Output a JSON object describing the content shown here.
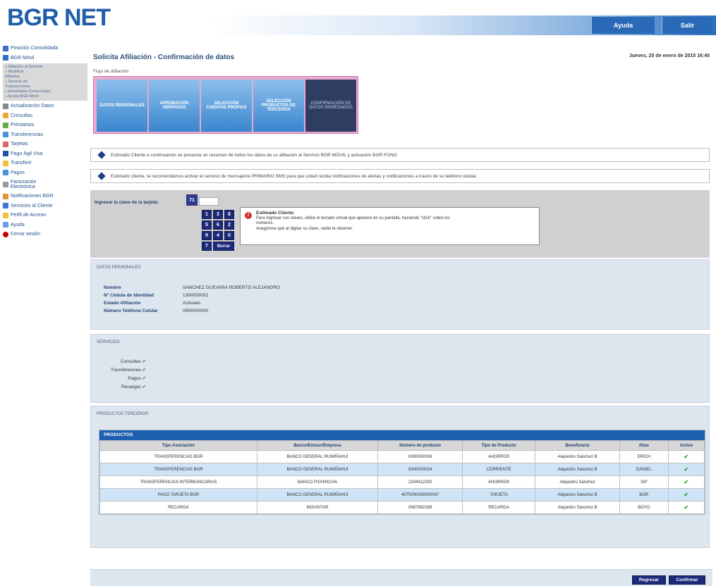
{
  "brand": {
    "logo": "BGR NET"
  },
  "header": {
    "help_label": "Ayuda",
    "exit_label": "Salir"
  },
  "sidebar": {
    "items": [
      {
        "label": "Posición Consolidada",
        "color": "#3a6fc4"
      },
      {
        "label": "BGR Móvil",
        "color": "#2f6fbf"
      },
      {
        "label": "Actualización Datos",
        "color": "#888888"
      },
      {
        "label": "Consultas",
        "color": "#f0a830"
      },
      {
        "label": "Préstamos",
        "color": "#6aa84f"
      },
      {
        "label": "Transferencias",
        "color": "#4a90d9"
      },
      {
        "label": "Tarjetas",
        "color": "#e06666"
      },
      {
        "label": "Pago Ágil Visa",
        "color": "#2255aa"
      },
      {
        "label": "Transferir",
        "color": "#f1c232"
      },
      {
        "label": "Pagos",
        "color": "#4a90d9"
      },
      {
        "label": "Facturación Electrónica",
        "color": "#999999"
      },
      {
        "label": "Notificaciones BGR",
        "color": "#e69138"
      },
      {
        "label": "Servicios al Cliente",
        "color": "#3c78d8"
      },
      {
        "label": "Perfil de Acceso",
        "color": "#f1c232"
      },
      {
        "label": "Ayuda",
        "color": "#6d9eeb"
      },
      {
        "label": "Cerrar sesión",
        "color": "#cc0000"
      }
    ],
    "sub_lines": [
      "» Afiliación al Servicio",
      "» Modificar",
      "  Afiliados",
      "» Servicio de",
      "Transacciones",
      "» Actividades Comerciales",
      "» Ayuda BGR Móvil"
    ]
  },
  "main": {
    "title": "Solicita Afiliación - Confirmación de datos",
    "date": "Jueves, 20 de enero de 2015 16:40",
    "flow_label": "Flujo de afiliación",
    "steps": [
      "DATOS PERSONALES",
      "APROBACIÓN SERVICIOS",
      "SELECCIÓN CUENTAS PROPIAS",
      "SELECCIÓN PRODUCTOS DE TERCEROS",
      "CONFIRMACIÓN DE DATOS INGRESADOS"
    ],
    "notices": [
      "Estimado Cliente a continuación se presenta un resumen de todos los datos de su afiliación al Servicio BGR MÓVIL y activación BGR FONO",
      "Estimado cliente, le recomendamos activar el servicio de mensajería PRIMARIO SMS para que usted reciba notificaciones de alertas y notificaciones a través de su teléfono celular."
    ],
    "keypad": {
      "label": "Ingresar la clave de la tarjeta:",
      "tab_label": "71",
      "keys": [
        "1",
        "3",
        "8",
        "5",
        "6",
        "2",
        "9",
        "4",
        "0",
        "7"
      ],
      "clear_label": "Borrar",
      "message_title": "Estimado Cliente:",
      "message_lines": [
        "Para ingresar sus claves, utilice el teclado virtual que aparece en su pantalla, haciendo \"click\" sobre los",
        "números.",
        "Asegúrese que al digitar su clave, nadie le observe."
      ]
    },
    "personal": {
      "title": "DATOS PERSONALES",
      "rows": [
        {
          "key": "Nombre",
          "value": "SANCHEZ GUEVARA ROBERTO ALEJANDRO"
        },
        {
          "key": "N° Cédula de Identidad",
          "value": "1300000002"
        },
        {
          "key": "Estado Afiliación",
          "value": "Activado"
        },
        {
          "key": "Número Teléfono Celular",
          "value": "0900000000"
        }
      ]
    },
    "services": {
      "title": "SERVICIOS",
      "items": [
        "Consultas",
        "Transferencias",
        "Pagos",
        "Recargas"
      ],
      "check": "✔"
    },
    "third_party": {
      "title": "PRODUCTOS TERCEROS",
      "table_title": "PRODUCTOS",
      "columns": [
        "Tipo Asociación",
        "Banco/Emisor/Empresa",
        "Número de producto",
        "Tipo de Producto",
        "Beneficiario",
        "Alias",
        "Activo"
      ],
      "rows": [
        [
          "TRANSFERENCIAS BGR",
          "BANCO GENERAL RUMIÑAHUI",
          "8300000008",
          "AHORROS",
          "Alejandro Sánchez B",
          "ERICH",
          "✔"
        ],
        [
          "TRANSFERENCIAS BGR",
          "BANCO GENERAL RUMIÑAHUI",
          "8300000024",
          "CORRIENTE",
          "Alejandro Sánchez B",
          "DANIEL",
          "✔"
        ],
        [
          "TRANSFERENCIAS INTERBANCARIAS",
          "BANCO PICHINCHA",
          "2204012250",
          "AHORROS",
          "Alejandro Sánchez",
          "SIP",
          "✔"
        ],
        [
          "PAGO TARJETA BGR",
          "BANCO GENERAL RUMIÑAHUI",
          "4075000000000047",
          "TARJETA",
          "Alejandro Sánchez B",
          "BGR",
          "✔"
        ],
        [
          "RECARGA",
          "MOVISTAR",
          "0987992398",
          "RECARGA",
          "Alejandro Sánchez B",
          "BOYO",
          "✔"
        ]
      ]
    }
  },
  "footer": {
    "back_label": "Regresar",
    "confirm_label": "Confirmar"
  }
}
